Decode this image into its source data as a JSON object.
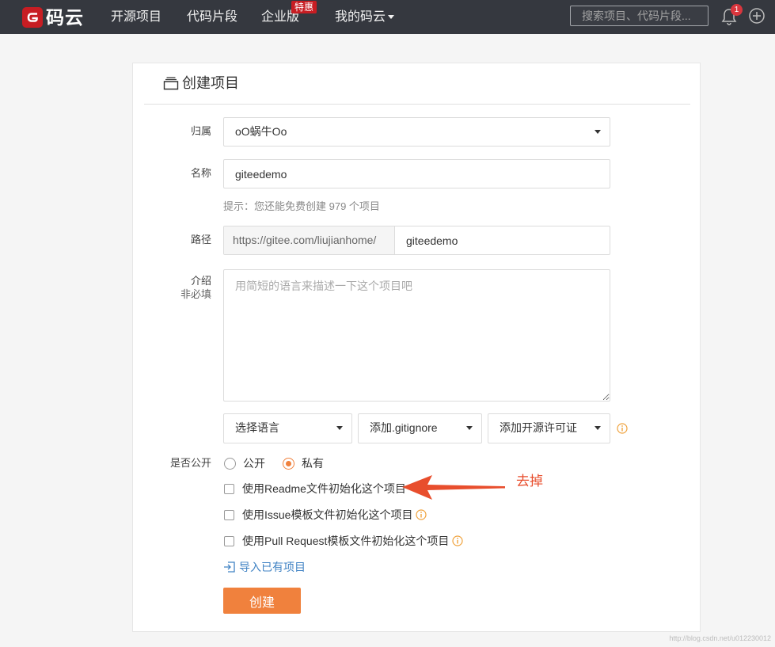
{
  "nav": {
    "logo_text": "码云",
    "items": [
      {
        "label": "开源项目"
      },
      {
        "label": "代码片段"
      },
      {
        "label": "企业版",
        "badge": "特惠"
      },
      {
        "label": "我的码云"
      }
    ],
    "search_placeholder": "搜索项目、代码片段...",
    "notification_count": "1"
  },
  "card": {
    "title": "创建项目"
  },
  "form": {
    "owner": {
      "label": "归属",
      "value": "oO蜗牛Oo"
    },
    "name": {
      "label": "名称",
      "value": "giteedemo"
    },
    "hint": "提示：您还能免费创建 979 个项目",
    "path": {
      "label": "路径",
      "prefix": "https://gitee.com/liujianhome/",
      "value": "giteedemo"
    },
    "description": {
      "label": "介绍",
      "sublabel": "非必填",
      "placeholder": "用简短的语言来描述一下这个项目吧",
      "value": ""
    },
    "language_select": "选择语言",
    "gitignore_select": "添加.gitignore",
    "license_select": "添加开源许可证",
    "visibility": {
      "label": "是否公开",
      "options": [
        {
          "label": "公开",
          "selected": false
        },
        {
          "label": "私有",
          "selected": true
        }
      ]
    },
    "init_options": [
      {
        "label": "使用Readme文件初始化这个项目",
        "checked": false
      },
      {
        "label": "使用Issue模板文件初始化这个项目",
        "checked": false
      },
      {
        "label": "使用Pull Request模板文件初始化这个项目",
        "checked": false
      }
    ],
    "import_link": "导入已有项目",
    "submit_label": "创建"
  },
  "annotation": {
    "text": "去掉"
  },
  "watermark": "http://blog.csdn.net/u012230012",
  "icons": {
    "logo": "gitee-logo-icon",
    "card_title": "project-box-icon",
    "notification": "bell-icon",
    "add": "plus-circle-icon",
    "dropdown": "caret-down-icon",
    "info": "info-circle-icon",
    "import": "sign-in-icon",
    "annotation": "arrow-left-icon"
  },
  "colors": {
    "nav_bg": "#35383f",
    "brand": "#c71d23",
    "accent": "#f0813d",
    "link": "#4183c4",
    "info": "#f0a23c",
    "annotation": "#e84e2d"
  }
}
